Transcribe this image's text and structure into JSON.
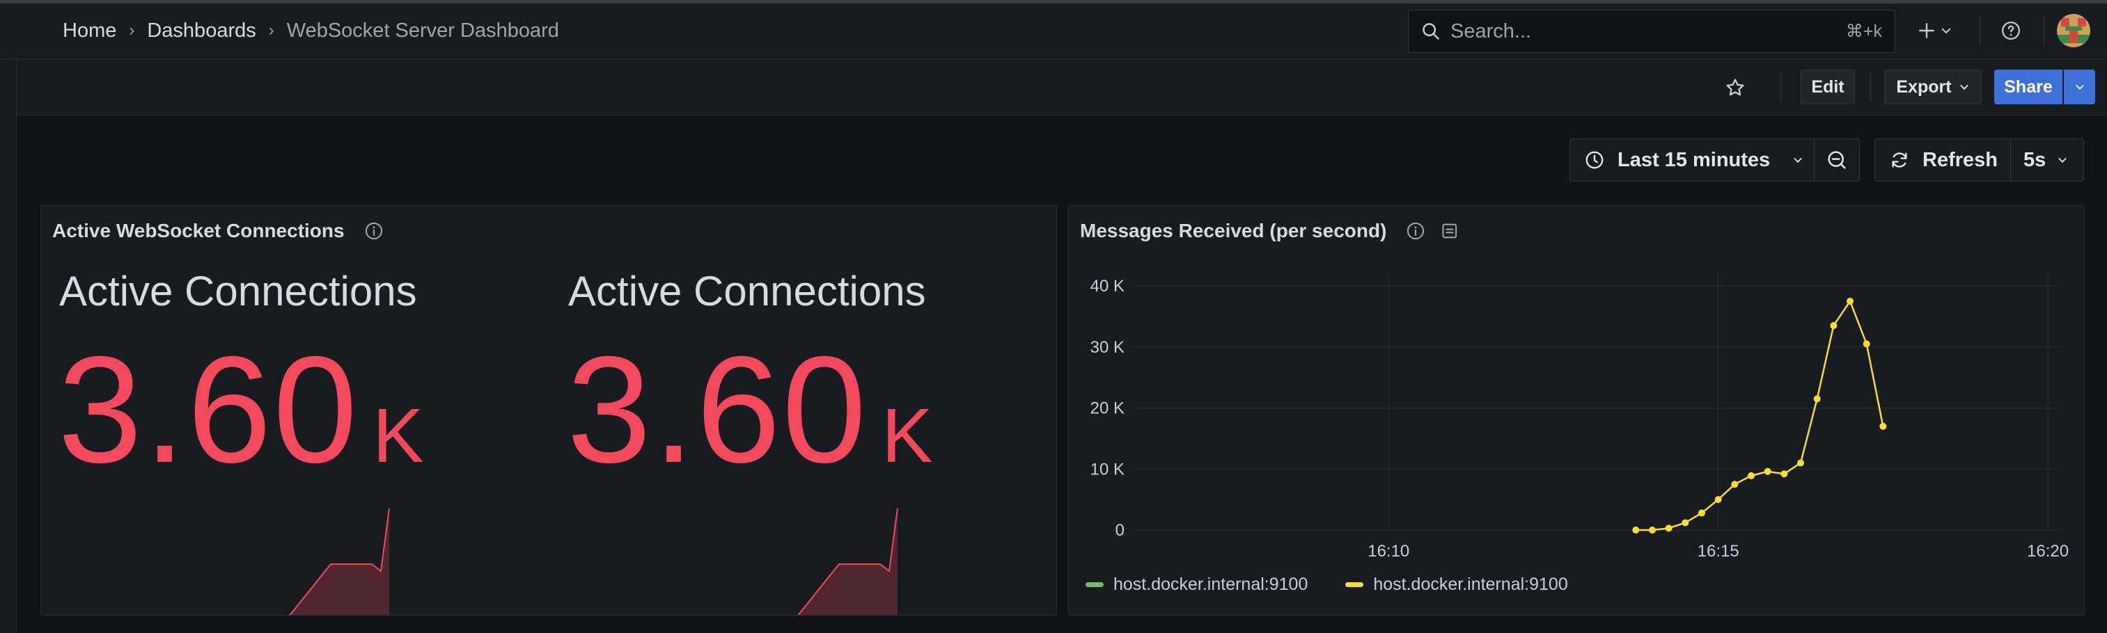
{
  "breadcrumb": {
    "home": "Home",
    "dashboards": "Dashboards",
    "current": "WebSocket Server Dashboard"
  },
  "search": {
    "placeholder": "Search...",
    "shortcut": "⌘+k"
  },
  "toolbar": {
    "edit": "Edit",
    "export": "Export",
    "share": "Share"
  },
  "time": {
    "range": "Last 15 minutes",
    "refresh": "Refresh",
    "interval": "5s"
  },
  "panels": {
    "active": {
      "title": "Active WebSocket Connections",
      "stats": [
        {
          "label": "Active Connections",
          "value": "3.60",
          "unit": "K"
        },
        {
          "label": "Active Connections",
          "value": "3.60",
          "unit": "K"
        }
      ]
    },
    "messages": {
      "title": "Messages Received (per second)",
      "legend": [
        {
          "name": "host.docker.internal:9100",
          "color": "#73bf69"
        },
        {
          "name": "host.docker.internal:9100",
          "color": "#fade2a"
        }
      ]
    }
  },
  "colors": {
    "stat": "#f2495c",
    "series": "#fade2a",
    "accent": "#3d71d9"
  },
  "chart_data": {
    "type": "line",
    "title": "Messages Received (per second)",
    "xlabel": "",
    "ylabel": "",
    "ylim": [
      0,
      40000
    ],
    "yticks": [
      "0",
      "10 K",
      "20 K",
      "30 K",
      "40 K"
    ],
    "xticks": [
      "16:10",
      "16:15",
      "16:20"
    ],
    "xlim": [
      "16:06:06",
      "16:20:12"
    ],
    "grid": true,
    "legend": "bottom-left",
    "series": [
      {
        "name": "host.docker.internal:9100",
        "color": "#fade2a",
        "x": [
          "16:13:45",
          "16:14:00",
          "16:14:15",
          "16:14:30",
          "16:14:45",
          "16:15:00",
          "16:15:15",
          "16:15:30",
          "16:15:45",
          "16:16:00",
          "16:16:15",
          "16:16:30",
          "16:16:45",
          "16:17:00",
          "16:17:15",
          "16:17:30"
        ],
        "values": [
          0,
          0,
          300,
          1200,
          2800,
          5000,
          7500,
          8900,
          9600,
          9200,
          11000,
          21500,
          33500,
          37500,
          30500,
          17000
        ]
      }
    ]
  }
}
